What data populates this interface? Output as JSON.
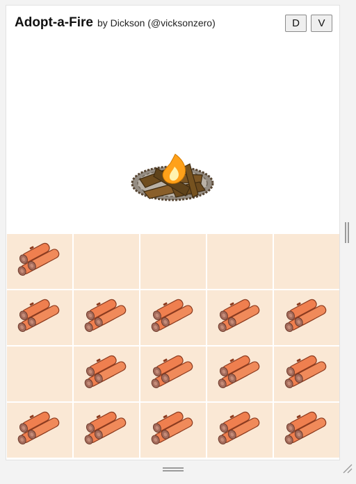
{
  "header": {
    "title": "Adopt-a-Fire",
    "byline": "by Dickson (@vicksonzero)"
  },
  "buttons": {
    "d_label": "D",
    "v_label": "V"
  },
  "inventory": {
    "columns": 5,
    "rows": 4,
    "item_icon": "firewood-logs-icon",
    "slots": [
      true,
      false,
      false,
      false,
      false,
      true,
      true,
      true,
      true,
      true,
      false,
      true,
      true,
      true,
      true,
      true,
      true,
      true,
      true,
      true
    ]
  },
  "colors": {
    "cell_background": "#fae8d5",
    "log_orange": "#ef7f4f",
    "flame": "#ffa11a",
    "wood_plank": "#7a5523",
    "stone_ring": "#8a8278"
  }
}
